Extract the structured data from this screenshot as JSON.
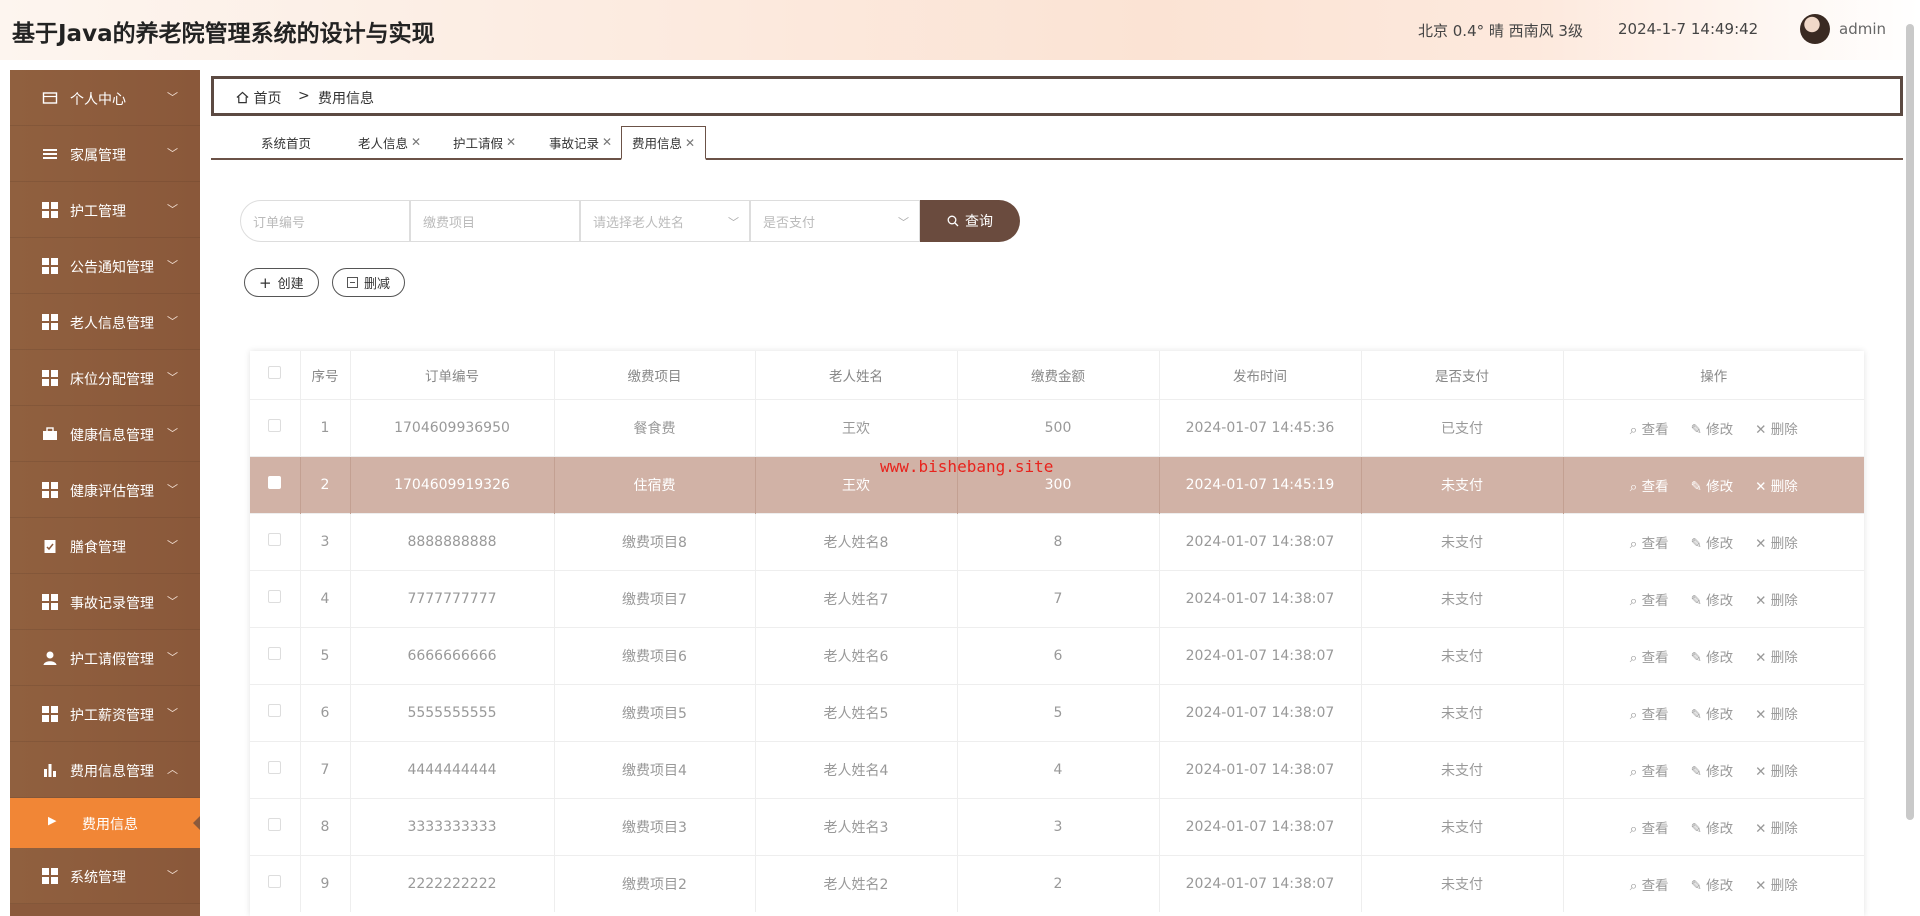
{
  "header": {
    "title": "基于Java的养老院管理系统的设计与实现",
    "weather": "北京 0.4° 晴 西南风 3级",
    "datetime": "2024-1-7 14:49:42",
    "user": "admin"
  },
  "sidebar": {
    "items": [
      {
        "label": "个人中心",
        "icon": "card-icon"
      },
      {
        "label": "家属管理",
        "icon": "list-icon"
      },
      {
        "label": "护工管理",
        "icon": "grid-icon"
      },
      {
        "label": "公告通知管理",
        "icon": "grid-icon"
      },
      {
        "label": "老人信息管理",
        "icon": "grid-icon"
      },
      {
        "label": "床位分配管理",
        "icon": "grid-icon"
      },
      {
        "label": "健康信息管理",
        "icon": "briefcase-icon"
      },
      {
        "label": "健康评估管理",
        "icon": "grid-icon"
      },
      {
        "label": "膳食管理",
        "icon": "clipboard-icon"
      },
      {
        "label": "事故记录管理",
        "icon": "grid-icon"
      },
      {
        "label": "护工请假管理",
        "icon": "user-icon"
      },
      {
        "label": "护工薪资管理",
        "icon": "grid-icon"
      },
      {
        "label": "费用信息管理",
        "icon": "bar-chart-icon"
      }
    ],
    "sub_item": "费用信息",
    "last_item": "系统管理"
  },
  "breadcrumb": {
    "home": "首页",
    "sep": ">",
    "current": "费用信息"
  },
  "tabs": [
    {
      "label": "系统首页",
      "closable": false
    },
    {
      "label": "老人信息",
      "closable": true
    },
    {
      "label": "护工请假",
      "closable": true
    },
    {
      "label": "事故记录",
      "closable": true
    },
    {
      "label": "费用信息",
      "closable": true
    }
  ],
  "search": {
    "order_placeholder": "订单编号",
    "item_placeholder": "缴费项目",
    "name_placeholder": "请选择老人姓名",
    "paid_placeholder": "是否支付",
    "button": "查询"
  },
  "actions": {
    "create": "创建",
    "delete": "删减"
  },
  "table": {
    "headers": [
      "序号",
      "订单编号",
      "缴费项目",
      "老人姓名",
      "缴费金额",
      "发布时间",
      "是否支付",
      "操作"
    ],
    "ops": {
      "view": "查看",
      "edit": "修改",
      "del": "删除"
    },
    "rows": [
      {
        "idx": "1",
        "order": "1704609936950",
        "item": "餐食费",
        "name": "王欢",
        "amount": "500",
        "time": "2024-01-07 14:45:36",
        "paid": "已支付"
      },
      {
        "idx": "2",
        "order": "1704609919326",
        "item": "住宿费",
        "name": "王欢",
        "amount": "300",
        "time": "2024-01-07 14:45:19",
        "paid": "未支付"
      },
      {
        "idx": "3",
        "order": "8888888888",
        "item": "缴费项目8",
        "name": "老人姓名8",
        "amount": "8",
        "time": "2024-01-07 14:38:07",
        "paid": "未支付"
      },
      {
        "idx": "4",
        "order": "7777777777",
        "item": "缴费项目7",
        "name": "老人姓名7",
        "amount": "7",
        "time": "2024-01-07 14:38:07",
        "paid": "未支付"
      },
      {
        "idx": "5",
        "order": "6666666666",
        "item": "缴费项目6",
        "name": "老人姓名6",
        "amount": "6",
        "time": "2024-01-07 14:38:07",
        "paid": "未支付"
      },
      {
        "idx": "6",
        "order": "5555555555",
        "item": "缴费项目5",
        "name": "老人姓名5",
        "amount": "5",
        "time": "2024-01-07 14:38:07",
        "paid": "未支付"
      },
      {
        "idx": "7",
        "order": "4444444444",
        "item": "缴费项目4",
        "name": "老人姓名4",
        "amount": "4",
        "time": "2024-01-07 14:38:07",
        "paid": "未支付"
      },
      {
        "idx": "8",
        "order": "3333333333",
        "item": "缴费项目3",
        "name": "老人姓名3",
        "amount": "3",
        "time": "2024-01-07 14:38:07",
        "paid": "未支付"
      },
      {
        "idx": "9",
        "order": "2222222222",
        "item": "缴费项目2",
        "name": "老人姓名2",
        "amount": "2",
        "time": "2024-01-07 14:38:07",
        "paid": "未支付"
      }
    ]
  },
  "watermark": "www.bishebang.site"
}
